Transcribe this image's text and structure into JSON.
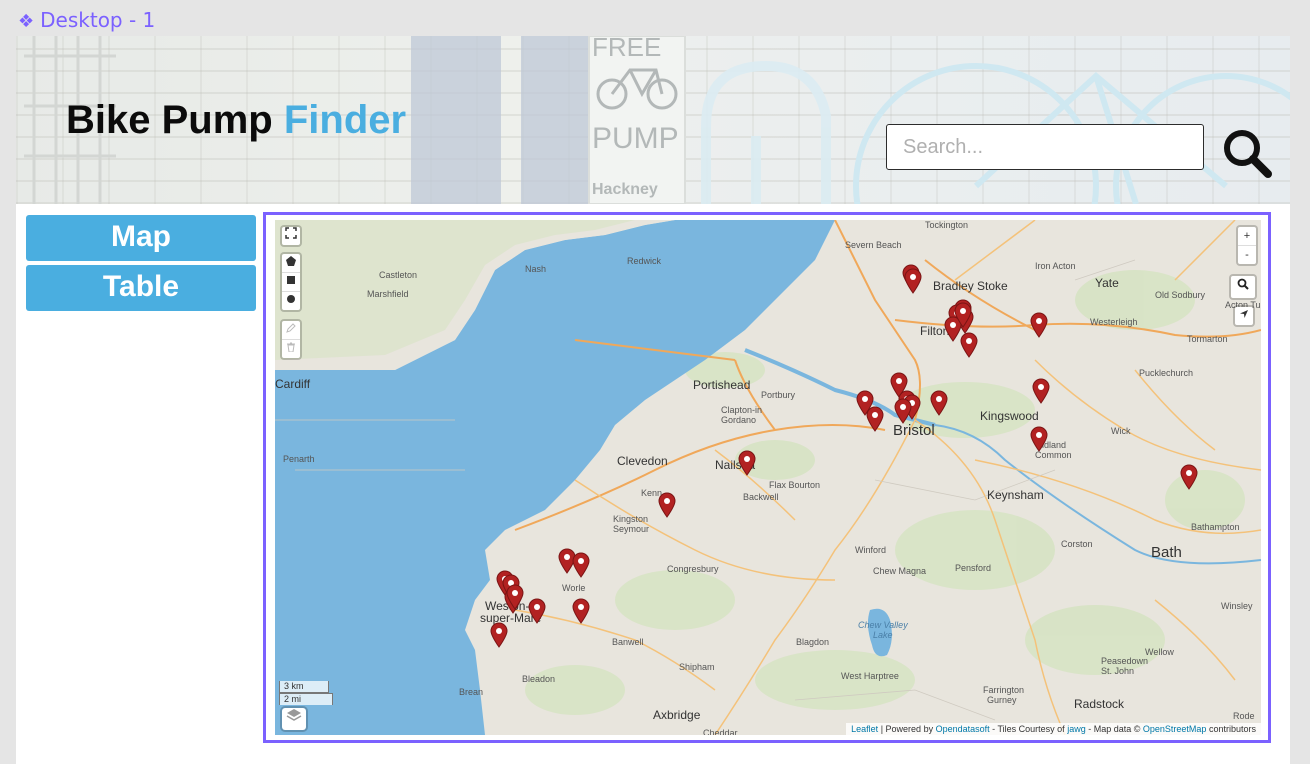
{
  "frame": {
    "label": "Desktop - 1"
  },
  "header": {
    "title_main": "Bike Pump",
    "title_accent": "Finder",
    "search_placeholder": "Search...",
    "search_value": ""
  },
  "nav": {
    "map_label": "Map",
    "table_label": "Table"
  },
  "map": {
    "controls": {
      "fullscreen": "⛶",
      "zoom_in": "+",
      "zoom_out": "-",
      "search": "search-icon",
      "locate": "locate-icon"
    },
    "scale": {
      "km": "3 km",
      "mi": "2 mi"
    },
    "attribution": {
      "leaflet": "Leaflet",
      "powered_by": "| Powered by",
      "opendatasoft": "Opendatasoft",
      "tiles": "- Tiles Courtesy of",
      "jawg": "jawg",
      "map_data": "- Map data ©",
      "osm": "OpenStreetMap",
      "contributors": "contributors"
    },
    "places": [
      {
        "name": "Severn Beach",
        "cls": ""
      },
      {
        "name": "Tockington",
        "cls": ""
      },
      {
        "name": "Redwick",
        "cls": ""
      },
      {
        "name": "Nash",
        "cls": ""
      },
      {
        "name": "Iron Acton",
        "cls": ""
      },
      {
        "name": "Bradley Stoke",
        "cls": "major"
      },
      {
        "name": "Yate",
        "cls": "major"
      },
      {
        "name": "Old Sodbury",
        "cls": ""
      },
      {
        "name": "Acton Turv",
        "cls": ""
      },
      {
        "name": "Castleton",
        "cls": ""
      },
      {
        "name": "Marshfield",
        "cls": ""
      },
      {
        "name": "Filton",
        "cls": "major"
      },
      {
        "name": "Westerleigh",
        "cls": ""
      },
      {
        "name": "Tormarton",
        "cls": ""
      },
      {
        "name": "Cardiff",
        "cls": "major"
      },
      {
        "name": "Pucklechurch",
        "cls": ""
      },
      {
        "name": "Portishead",
        "cls": "major"
      },
      {
        "name": "Portbury",
        "cls": ""
      },
      {
        "name": "Kingswood",
        "cls": "major"
      },
      {
        "name": "Clapton-in",
        "cls": ""
      },
      {
        "name": "Gordano",
        "cls": ""
      },
      {
        "name": "Bristol",
        "cls": "big"
      },
      {
        "name": "Wick",
        "cls": ""
      },
      {
        "name": "Penarth",
        "cls": ""
      },
      {
        "name": "Clevedon",
        "cls": "major"
      },
      {
        "name": "Nailsea",
        "cls": "major"
      },
      {
        "name": "Oldland",
        "cls": ""
      },
      {
        "name": "Common",
        "cls": ""
      },
      {
        "name": "Flax Bourton",
        "cls": ""
      },
      {
        "name": "Backwell",
        "cls": ""
      },
      {
        "name": "Kenn",
        "cls": ""
      },
      {
        "name": "Keynsham",
        "cls": "major"
      },
      {
        "name": "Kingston",
        "cls": ""
      },
      {
        "name": "Seymour",
        "cls": ""
      },
      {
        "name": "Bathampton",
        "cls": ""
      },
      {
        "name": "Corston",
        "cls": ""
      },
      {
        "name": "Winford",
        "cls": ""
      },
      {
        "name": "Bath",
        "cls": "big"
      },
      {
        "name": "Congresbury",
        "cls": ""
      },
      {
        "name": "Chew Magna",
        "cls": ""
      },
      {
        "name": "Pensford",
        "cls": ""
      },
      {
        "name": "Worle",
        "cls": ""
      },
      {
        "name": "Weston-",
        "cls": "major"
      },
      {
        "name": "super-Mare",
        "cls": "major"
      },
      {
        "name": "Chew Valley",
        "cls": "lake"
      },
      {
        "name": "Lake",
        "cls": "lake"
      },
      {
        "name": "Winsley",
        "cls": ""
      },
      {
        "name": "Banwell",
        "cls": ""
      },
      {
        "name": "Blagdon",
        "cls": ""
      },
      {
        "name": "Wellow",
        "cls": ""
      },
      {
        "name": "Shipham",
        "cls": ""
      },
      {
        "name": "Peasedown",
        "cls": ""
      },
      {
        "name": "St. John",
        "cls": ""
      },
      {
        "name": "West Harptree",
        "cls": ""
      },
      {
        "name": "Bleadon",
        "cls": ""
      },
      {
        "name": "Farrington",
        "cls": ""
      },
      {
        "name": "Gurney",
        "cls": ""
      },
      {
        "name": "Brean",
        "cls": ""
      },
      {
        "name": "Radstock",
        "cls": "major"
      },
      {
        "name": "Axbridge",
        "cls": "major"
      },
      {
        "name": "Cheddar",
        "cls": ""
      },
      {
        "name": "Rode",
        "cls": ""
      }
    ],
    "marker_count": 30
  }
}
